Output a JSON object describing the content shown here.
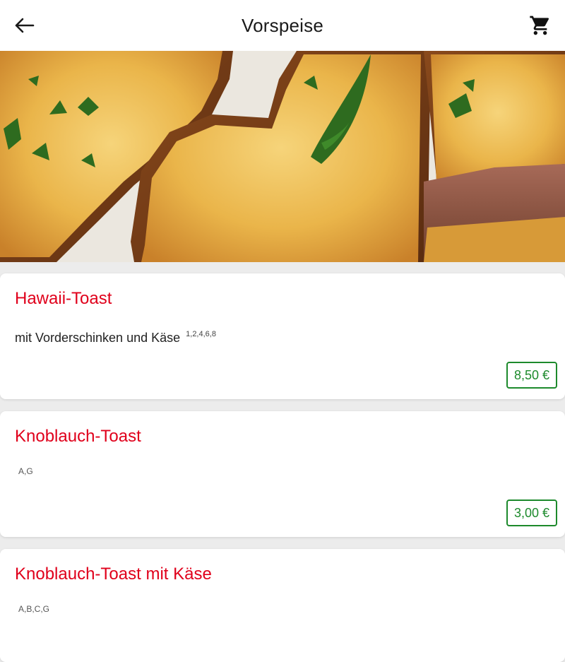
{
  "appbar": {
    "title": "Vorspeise",
    "back_icon": "arrow-left-icon",
    "cart_icon": "shopping-cart-icon"
  },
  "hero": {
    "image": "garlic-toast-photo"
  },
  "items": [
    {
      "name": "Hawaii-Toast",
      "description": "mit Vorderschinken und Käse",
      "additives": "1,2,4,6,8",
      "price": "8,50 €"
    },
    {
      "name": "Knoblauch-Toast",
      "allergens": "A,G",
      "price": "3,00 €"
    },
    {
      "name": "Knoblauch-Toast mit Käse",
      "allergens": "A,B,C,G"
    }
  ],
  "colors": {
    "accent": "#e0001b",
    "price": "#1d8a2c",
    "background": "#ececec"
  }
}
